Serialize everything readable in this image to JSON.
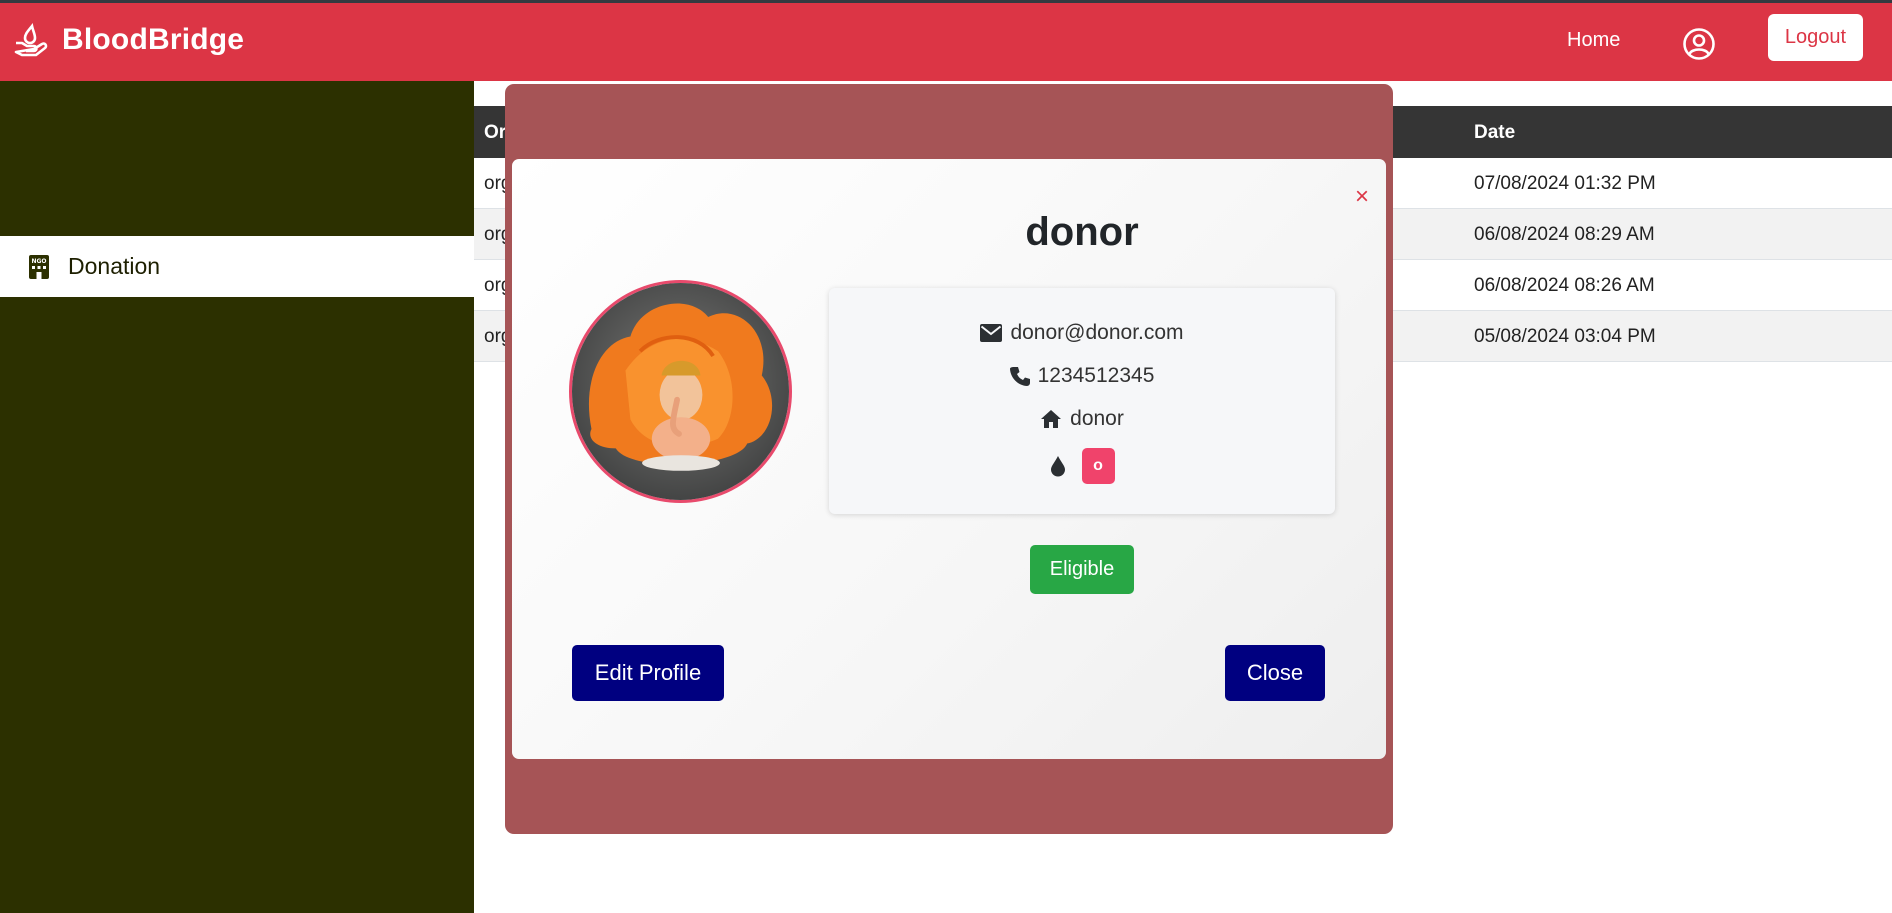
{
  "navbar": {
    "brand": "BloodBridge",
    "home_label": "Home",
    "logout_label": "Logout",
    "brand_color": "#dc3545"
  },
  "sidebar": {
    "items": [
      {
        "label": "Donation",
        "icon": "ngo-building-icon"
      }
    ]
  },
  "table": {
    "columns": [
      "Or",
      "Date"
    ],
    "rows": [
      {
        "org": "org",
        "date": "07/08/2024 01:32 PM"
      },
      {
        "org": "org",
        "date": "06/08/2024 08:29 AM"
      },
      {
        "org": "org",
        "date": "06/08/2024 08:26 AM"
      },
      {
        "org": "org",
        "date": "05/08/2024 03:04 PM"
      }
    ]
  },
  "modal": {
    "title": "donor",
    "close_x": "×",
    "email": "donor@donor.com",
    "phone": "1234512345",
    "address": "donor",
    "blood_group": "o",
    "status": "Eligible",
    "edit_label": "Edit Profile",
    "close_label": "Close",
    "accent_color": "#000080",
    "status_color": "#28a745"
  }
}
